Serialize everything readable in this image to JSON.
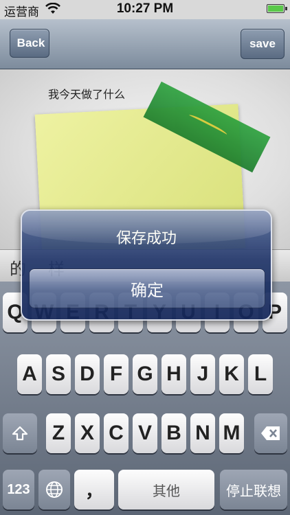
{
  "status_bar": {
    "carrier": "运营商",
    "time": "10:27 PM"
  },
  "nav": {
    "back_label": "Back",
    "save_label": "save"
  },
  "note": {
    "text": "我今天做了什么"
  },
  "suggestions": [
    "的",
    "样"
  ],
  "keyboard": {
    "row1": [
      "Q",
      "W",
      "E",
      "R",
      "T",
      "Y",
      "U",
      "I",
      "O",
      "P"
    ],
    "row2": [
      "A",
      "S",
      "D",
      "F",
      "G",
      "H",
      "J",
      "K",
      "L"
    ],
    "row3": [
      "Z",
      "X",
      "C",
      "V",
      "B",
      "N",
      "M"
    ],
    "numbers_key": "123",
    "comma_key": "，",
    "space_key": "其他",
    "stop_key": "停止联想"
  },
  "alert": {
    "title": "保存成功",
    "confirm_label": "确定"
  },
  "colors": {
    "tape": "#1d7e2d",
    "note": "#e3e88f",
    "alert_bg": "#1c2f63"
  }
}
